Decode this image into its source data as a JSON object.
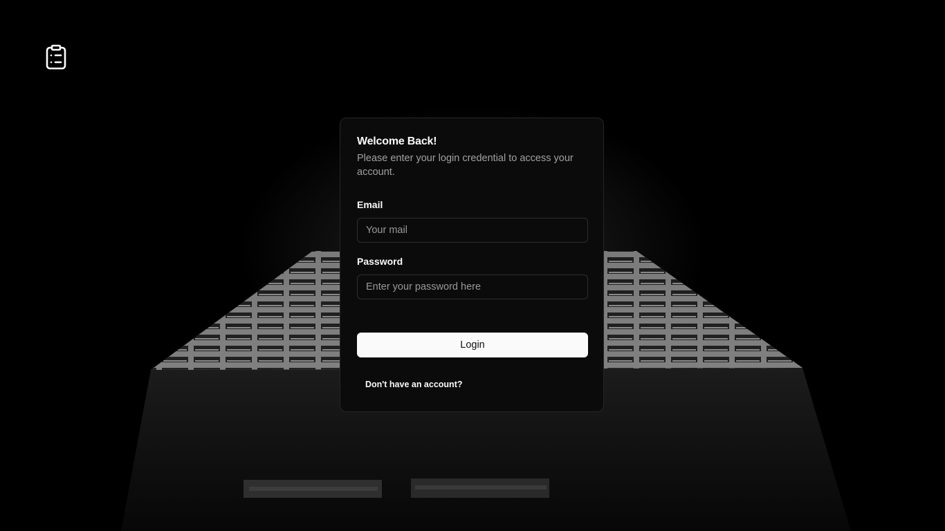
{
  "app": {
    "logo_icon": "clipboard-list-icon"
  },
  "login": {
    "title": "Welcome Back!",
    "subtitle": "Please enter your login credential to access your account.",
    "email_label": "Email",
    "email_placeholder": "Your mail",
    "email_value": "",
    "password_label": "Password",
    "password_placeholder": "Enter your password here",
    "password_value": "",
    "submit_label": "Login",
    "signup_link": "Don't have an account?"
  },
  "colors": {
    "background": "#000000",
    "card": "#0b0b0b",
    "card_border": "#262626",
    "text_primary": "#fafafa",
    "text_muted": "#a1a1a1",
    "button_bg": "#fafafa",
    "button_text": "#111111"
  }
}
